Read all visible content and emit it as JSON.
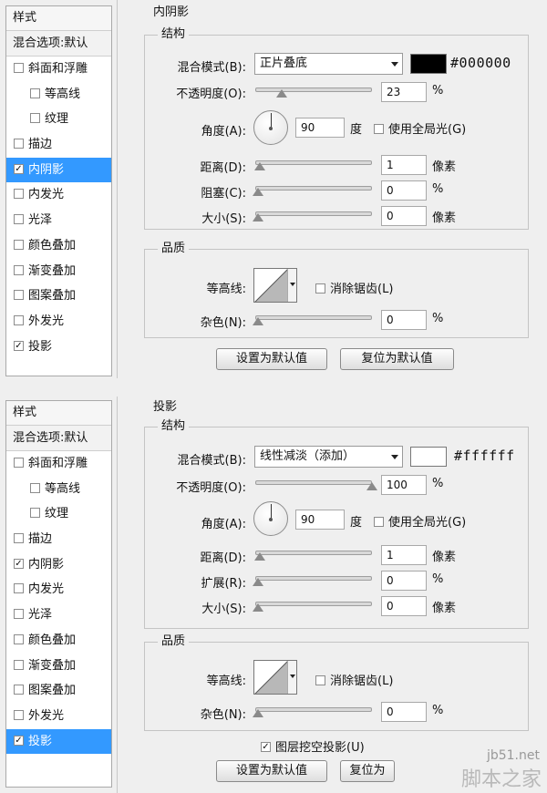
{
  "styles_header": "样式",
  "blend_options": "混合选项:默认",
  "panel1": {
    "style_items": [
      {
        "label": "斜面和浮雕",
        "checked": false,
        "sub": false,
        "selected": false
      },
      {
        "label": "等高线",
        "checked": false,
        "sub": true,
        "selected": false
      },
      {
        "label": "纹理",
        "checked": false,
        "sub": true,
        "selected": false
      },
      {
        "label": "描边",
        "checked": false,
        "sub": false,
        "selected": false
      },
      {
        "label": "内阴影",
        "checked": true,
        "sub": false,
        "selected": true
      },
      {
        "label": "内发光",
        "checked": false,
        "sub": false,
        "selected": false
      },
      {
        "label": "光泽",
        "checked": false,
        "sub": false,
        "selected": false
      },
      {
        "label": "颜色叠加",
        "checked": false,
        "sub": false,
        "selected": false
      },
      {
        "label": "渐变叠加",
        "checked": false,
        "sub": false,
        "selected": false
      },
      {
        "label": "图案叠加",
        "checked": false,
        "sub": false,
        "selected": false
      },
      {
        "label": "外发光",
        "checked": false,
        "sub": false,
        "selected": false
      },
      {
        "label": "投影",
        "checked": true,
        "sub": false,
        "selected": false
      }
    ],
    "section_title": "内阴影",
    "structure_title": "结构",
    "blend_mode_label": "混合模式(B):",
    "blend_mode_value": "正片叠底",
    "color_hex": "#000000",
    "color_swatch": "#000000",
    "opacity_label": "不透明度(O):",
    "opacity_value": "23",
    "opacity_unit": "%",
    "opacity_fraction": 0.23,
    "angle_label": "角度(A):",
    "angle_value": "90",
    "angle_unit": "度",
    "global_light_label": "使用全局光(G)",
    "global_light_checked": false,
    "distance_label": "距离(D):",
    "distance_value": "1",
    "distance_unit": "像素",
    "choke_label": "阻塞(C):",
    "choke_value": "0",
    "choke_unit": "%",
    "size_label": "大小(S):",
    "size_value": "0",
    "size_unit": "像素",
    "quality_title": "品质",
    "contour_label": "等高线:",
    "antialias_label": "消除锯齿(L)",
    "noise_label": "杂色(N):",
    "noise_value": "0",
    "noise_unit": "%",
    "btn_make_default": "设置为默认值",
    "btn_reset_default": "复位为默认值"
  },
  "panel2": {
    "style_items": [
      {
        "label": "斜面和浮雕",
        "checked": false,
        "sub": false,
        "selected": false
      },
      {
        "label": "等高线",
        "checked": false,
        "sub": true,
        "selected": false
      },
      {
        "label": "纹理",
        "checked": false,
        "sub": true,
        "selected": false
      },
      {
        "label": "描边",
        "checked": false,
        "sub": false,
        "selected": false
      },
      {
        "label": "内阴影",
        "checked": true,
        "sub": false,
        "selected": false
      },
      {
        "label": "内发光",
        "checked": false,
        "sub": false,
        "selected": false
      },
      {
        "label": "光泽",
        "checked": false,
        "sub": false,
        "selected": false
      },
      {
        "label": "颜色叠加",
        "checked": false,
        "sub": false,
        "selected": false
      },
      {
        "label": "渐变叠加",
        "checked": false,
        "sub": false,
        "selected": false
      },
      {
        "label": "图案叠加",
        "checked": false,
        "sub": false,
        "selected": false
      },
      {
        "label": "外发光",
        "checked": false,
        "sub": false,
        "selected": false
      },
      {
        "label": "投影",
        "checked": true,
        "sub": false,
        "selected": true
      }
    ],
    "section_title": "投影",
    "structure_title": "结构",
    "blend_mode_label": "混合模式(B):",
    "blend_mode_value": "线性减淡（添加）",
    "color_hex": "#ffffff",
    "color_swatch": "#ffffff",
    "opacity_label": "不透明度(O):",
    "opacity_value": "100",
    "opacity_unit": "%",
    "opacity_fraction": 1.0,
    "angle_label": "角度(A):",
    "angle_value": "90",
    "angle_unit": "度",
    "global_light_label": "使用全局光(G)",
    "global_light_checked": false,
    "distance_label": "距离(D):",
    "distance_value": "1",
    "distance_unit": "像素",
    "spread_label": "扩展(R):",
    "spread_value": "0",
    "spread_unit": "%",
    "size_label": "大小(S):",
    "size_value": "0",
    "size_unit": "像素",
    "quality_title": "品质",
    "contour_label": "等高线:",
    "antialias_label": "消除锯齿(L)",
    "noise_label": "杂色(N):",
    "noise_value": "0",
    "noise_unit": "%",
    "knockout_label": "图层挖空投影(U)",
    "knockout_checked": true,
    "btn_make_default": "设置为默认值",
    "btn_reset_default": "复位为"
  },
  "watermark_small": "jb51.net",
  "watermark_big": "脚本之家"
}
